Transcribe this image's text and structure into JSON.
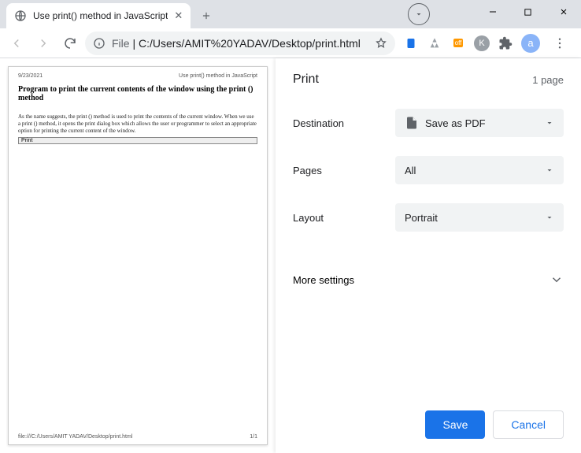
{
  "tab": {
    "title": "Use print() method in JavaScript"
  },
  "address": {
    "prefix": "File",
    "path": "C:/Users/AMIT%20YADAV/Desktop/print.html"
  },
  "avatar_letter": "a",
  "ext_badge": "off",
  "panel": {
    "title": "Print",
    "page_count": "1 page",
    "destination_label": "Destination",
    "destination_value": "Save as PDF",
    "pages_label": "Pages",
    "pages_value": "All",
    "layout_label": "Layout",
    "layout_value": "Portrait",
    "more": "More settings",
    "save": "Save",
    "cancel": "Cancel"
  },
  "preview": {
    "date": "9/23/2021",
    "header": "Use print() method in JavaScript",
    "title": "Program to print the current contents of the window using the print () method",
    "body": "As the name suggests, the print () method is used to print the contents of the current window. When we use a print () method, it opens the print dialog box which allows the user or programmer to select an appropriate option for printing the current content of the window.",
    "btn": "Print",
    "footer_path": "file:///C:/Users/AMIT YADAV/Desktop/print.html",
    "footer_page": "1/1"
  }
}
